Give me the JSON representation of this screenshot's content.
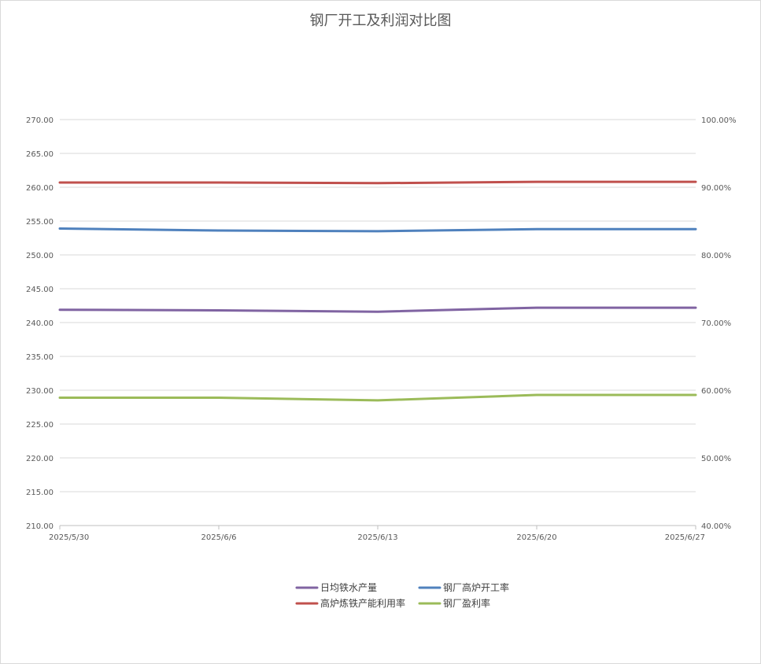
{
  "chart_data": {
    "type": "line",
    "title": "钢厂开工及利润对比图",
    "categories": [
      "2025/5/30",
      "2025/6/6",
      "2025/6/13",
      "2025/6/20",
      "2025/6/27"
    ],
    "x_dates": [
      "2025/5/30",
      "2025/6/6",
      "2025/6/13",
      "2025/6/20",
      "2025/6/27"
    ],
    "left_axis": {
      "min": 210,
      "max": 270,
      "step": 5,
      "tick_labels": [
        "210.00",
        "215.00",
        "220.00",
        "225.00",
        "230.00",
        "235.00",
        "240.00",
        "245.00",
        "250.00",
        "255.00",
        "260.00",
        "265.00",
        "270.00"
      ]
    },
    "right_axis": {
      "min": 40,
      "max": 100,
      "step": 10,
      "tick_labels": [
        "40.00%",
        "50.00%",
        "60.00%",
        "70.00%",
        "80.00%",
        "90.00%",
        "100.00%"
      ]
    },
    "series": [
      {
        "name": "日均铁水产量",
        "axis": "left",
        "color": "#8064A2",
        "x": [
          "2025/5/30",
          "2025/6/6",
          "2025/6/13",
          "2025/6/20",
          "2025/6/27"
        ],
        "values": [
          241.9,
          241.8,
          241.6,
          242.2,
          242.2
        ]
      },
      {
        "name": "钢厂高炉开工率",
        "axis": "right",
        "color": "#4F81BD",
        "x": [
          "2025/5/30",
          "2025/6/6",
          "2025/6/13",
          "2025/6/20",
          "2025/6/27"
        ],
        "values": [
          83.9,
          83.6,
          83.5,
          83.8,
          83.8
        ]
      },
      {
        "name": "高炉炼铁产能利用率",
        "axis": "right",
        "color": "#C0504D",
        "x": [
          "2025/5/30",
          "2025/6/6",
          "2025/6/13",
          "2025/6/20",
          "2025/6/27"
        ],
        "values": [
          90.7,
          90.7,
          90.6,
          90.8,
          90.8
        ]
      },
      {
        "name": "钢厂盈利率",
        "axis": "right",
        "color": "#9BBB59",
        "x": [
          "2025/5/30",
          "2025/6/6",
          "2025/6/13",
          "2025/6/20",
          "2025/6/27"
        ],
        "values": [
          58.9,
          58.9,
          58.5,
          59.3,
          59.3
        ]
      }
    ],
    "legend_order": [
      0,
      1,
      2,
      3
    ],
    "legend_position": "bottom",
    "grid": true
  }
}
